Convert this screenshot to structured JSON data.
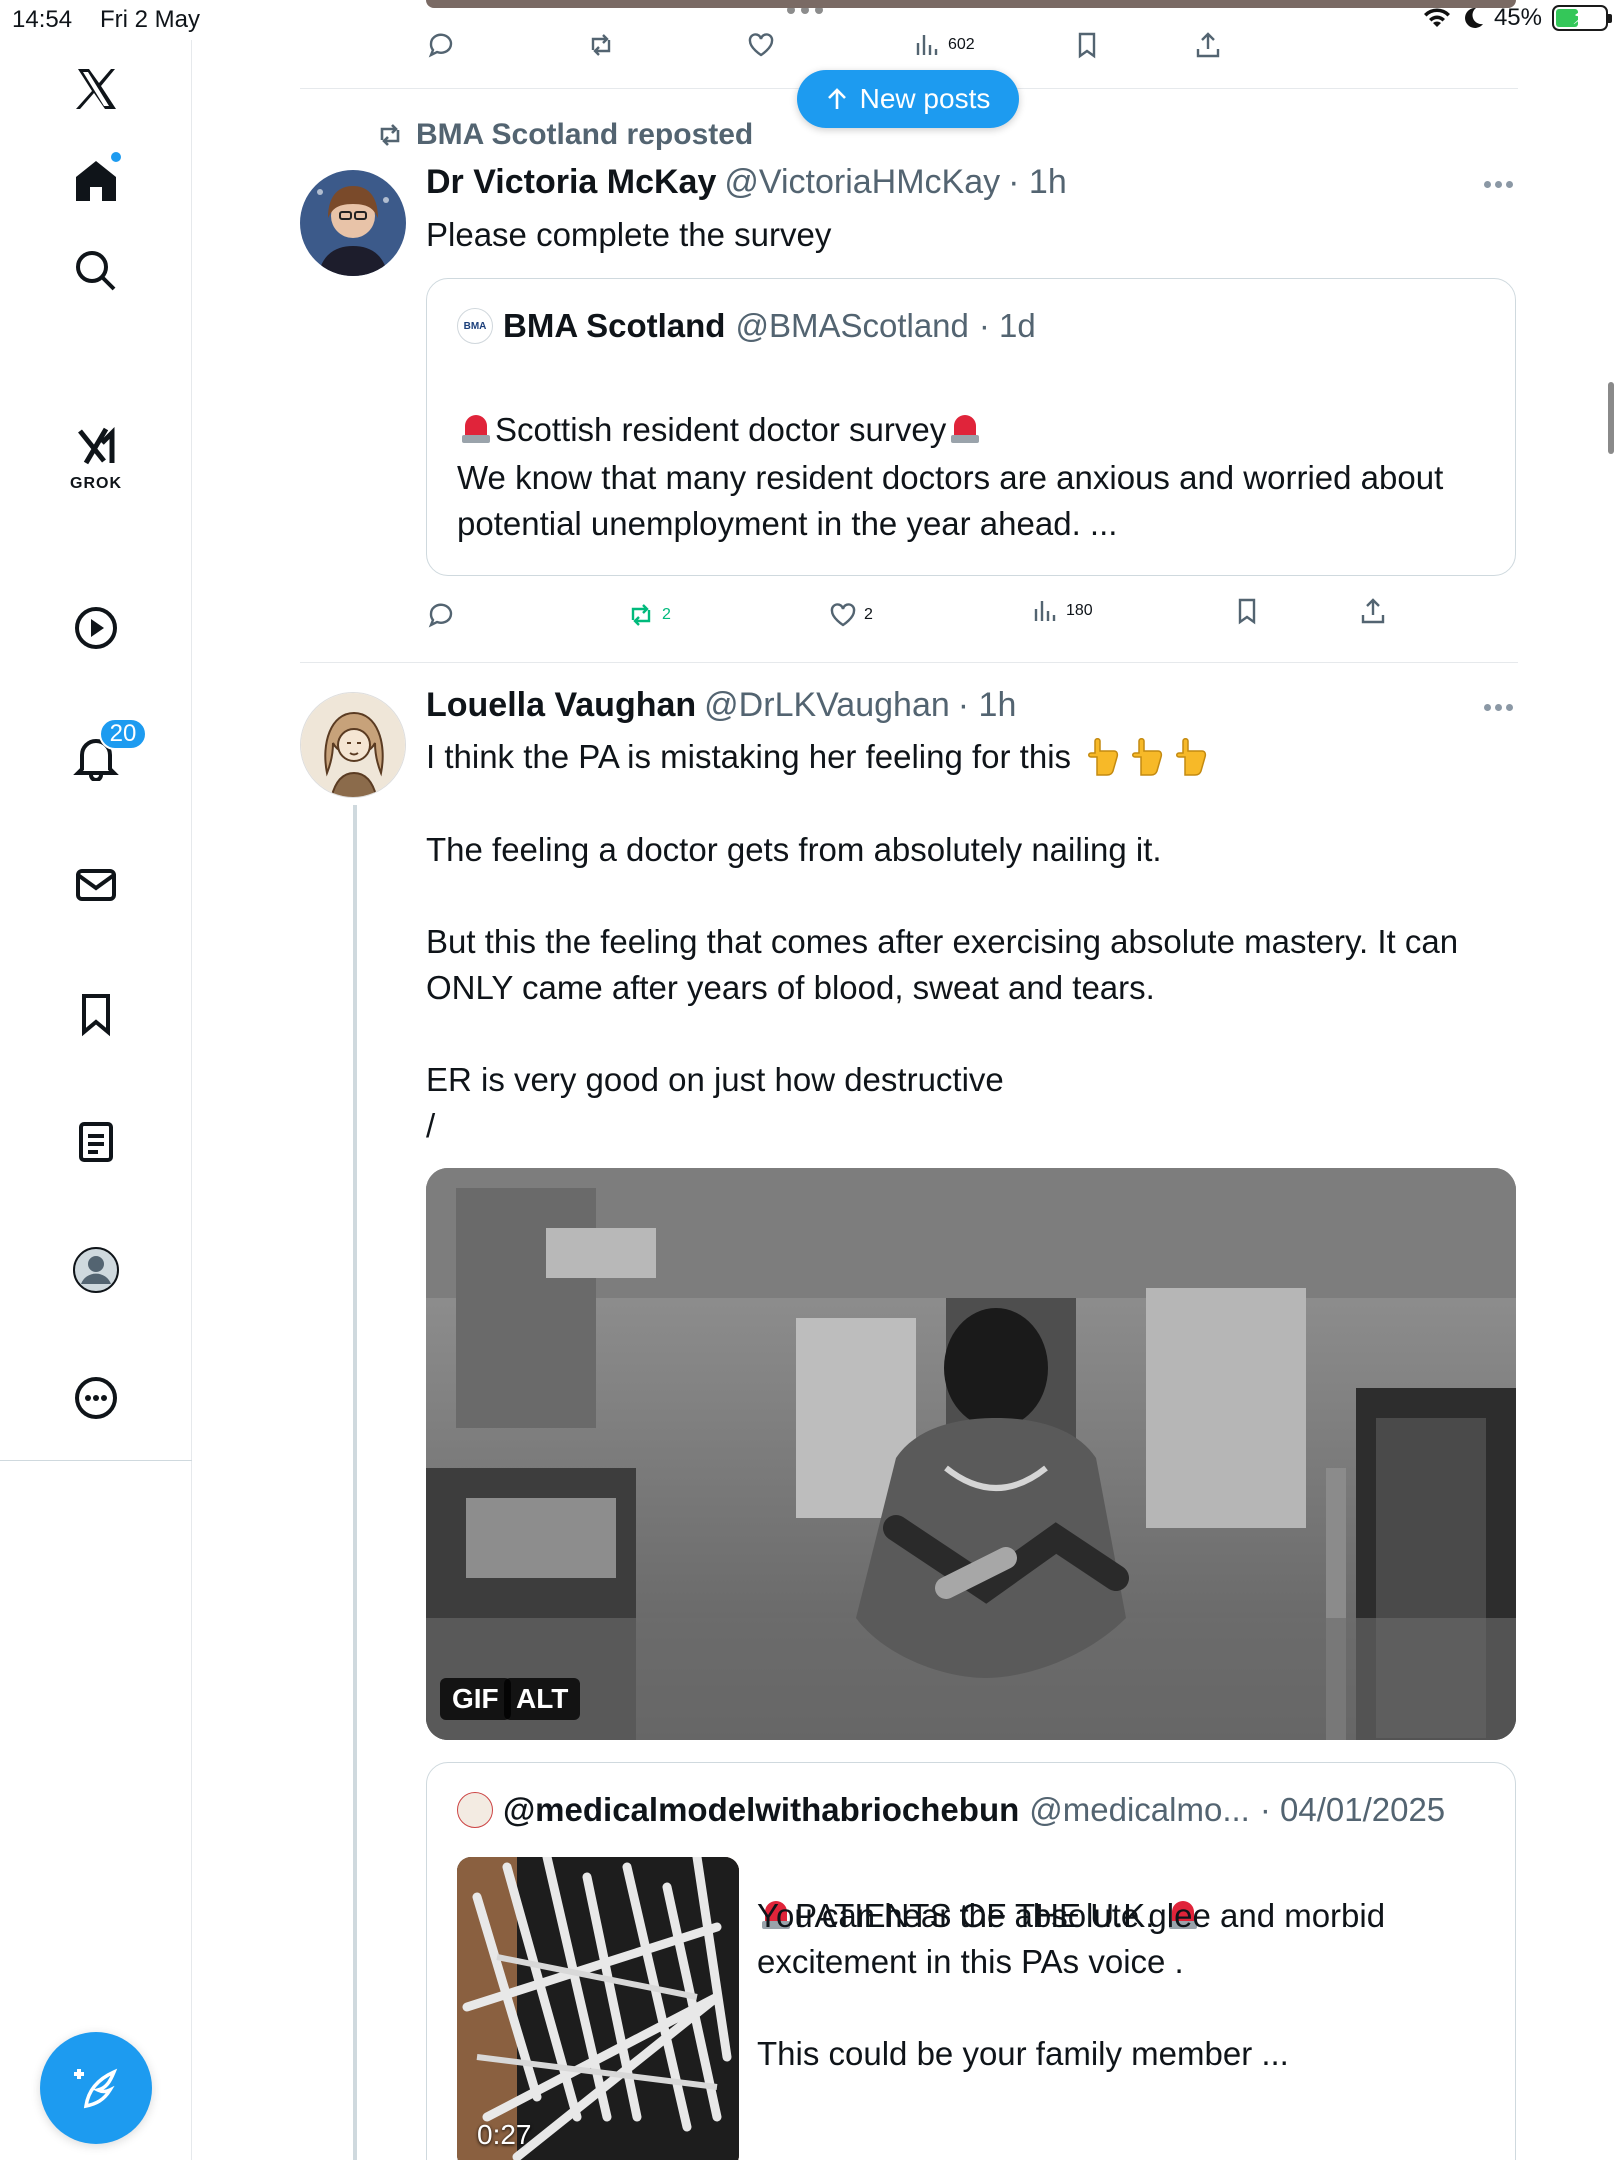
{
  "status_bar": {
    "time": "14:54",
    "date": "Fri 2 May",
    "battery": "45%",
    "battery_level": 0.45
  },
  "sidebar": {
    "items": [
      {
        "name": "x-logo-icon"
      },
      {
        "name": "home-icon",
        "has_dot": true
      },
      {
        "name": "search-icon"
      },
      {
        "name": "grok-icon",
        "label": "GROK"
      },
      {
        "name": "video-icon"
      },
      {
        "name": "notifications-icon",
        "badge": "20"
      },
      {
        "name": "messages-icon"
      },
      {
        "name": "bookmarks-icon"
      },
      {
        "name": "lists-icon"
      },
      {
        "name": "profile-icon"
      },
      {
        "name": "more-icon"
      }
    ],
    "compose_icon": "compose-post-icon"
  },
  "top_post": {
    "views": "602"
  },
  "new_posts": {
    "label": "New posts"
  },
  "post1": {
    "reposted_by": "BMA Scotland reposted",
    "name": "Dr Victoria McKay",
    "handle": "@VictoriaHMcKay",
    "time": "· 1h",
    "text": "Please complete the survey",
    "quote": {
      "avatar_text": "BMA",
      "name": "BMA Scotland",
      "handle": "@BMAScotland",
      "time": "· 1d",
      "title": "Scottish resident doctor survey",
      "body": "We know that many resident doctors are anxious and worried about\npotential unemployment in the year ahead.  ..."
    },
    "reposts": "2",
    "likes": "2",
    "views": "180"
  },
  "post2": {
    "name": "Louella Vaughan",
    "handle": "@DrLKVaughan",
    "time": "· 1h",
    "text_line1": "I think the PA is mistaking her feeling for this",
    "text_rest": "The feeling a doctor gets from absolutely nailing it.\n\nBut this the feeling that comes after exercising absolute mastery. It can\nONLY came after years of blood, sweat and tears.\n\nER is very good on just how destructive\n/",
    "media_tags": {
      "gif": "GIF",
      "alt": "ALT"
    },
    "quote": {
      "name": "@medicalmodelwithabriochebun",
      "handle": "@medicalmo...",
      "date": "· 04/01/2025",
      "line1": "PATIENTS OF THE U.K.",
      "body": "You can hear the absolute glee and morbid\nexcitement in this PAs voice .\n\nThis could be your family member ...",
      "duration": "0:27"
    }
  },
  "colors": {
    "accent": "#1d9bf0",
    "repost_green": "#00ba7c",
    "muted": "#536471"
  }
}
